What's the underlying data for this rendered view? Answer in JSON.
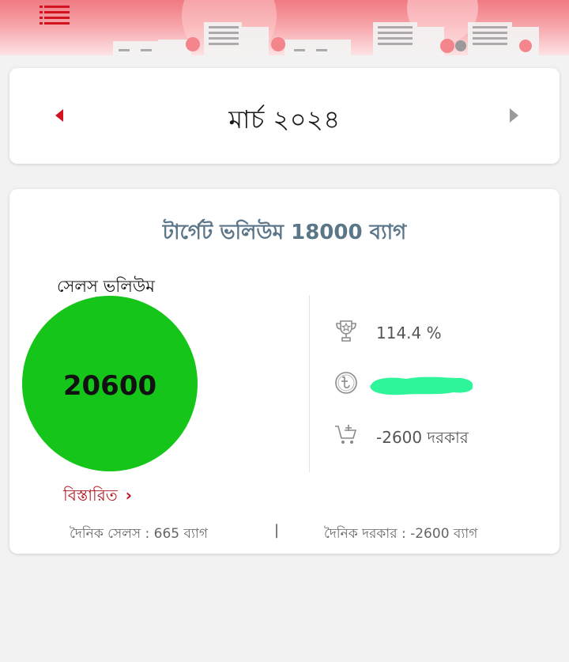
{
  "header": {
    "menu_icon": "hamburger-menu-icon"
  },
  "month_selector": {
    "title": "মার্চ ২০২৪",
    "prev_icon": "caret-left-icon",
    "next_icon": "caret-right-icon",
    "prev_color": "#d3121f",
    "next_color": "#9a9a9a"
  },
  "summary": {
    "target_title": "টার্গেট ভলিউম 18000 ব্যাগ",
    "sales_label": "সেলস ভলিউম",
    "sales_value": "20600",
    "circle_color": "#16c51a",
    "details_link": "বিস্তারিত",
    "stats": {
      "achievement": "114.4 %",
      "achievement_icon": "trophy-icon",
      "amount_icon": "taka-coin-icon",
      "required": "-2600 দরকার",
      "required_icon": "cart-plus-icon"
    },
    "footer": {
      "daily_sales": "দৈনিক সেলস : 665 ব্যাগ",
      "separator": "|",
      "daily_required": "দৈনিক দরকার : -2600 ব্যাগ"
    }
  },
  "colors": {
    "accent_red": "#d3121f",
    "title_slate": "#5b7589",
    "redaction_green": "#2ef59a"
  }
}
